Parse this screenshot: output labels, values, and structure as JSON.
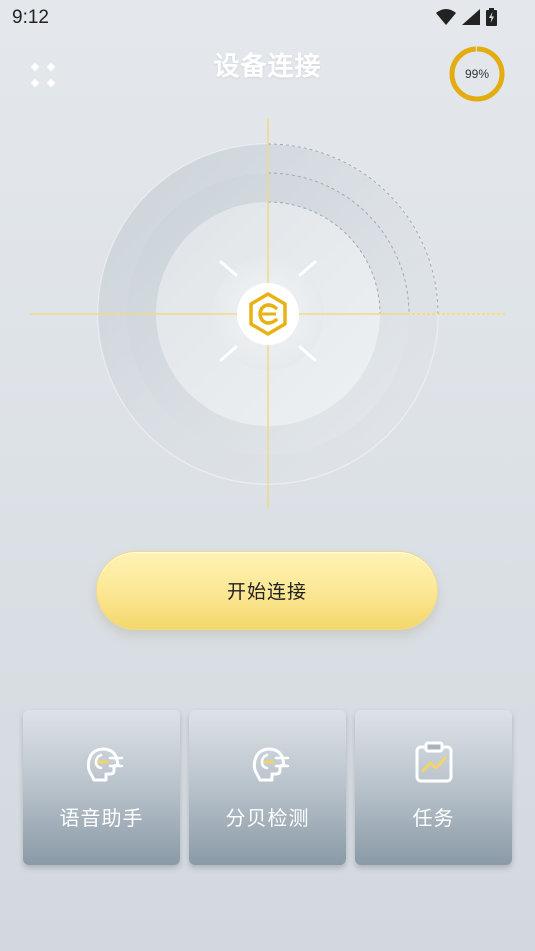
{
  "status_bar": {
    "time": "9:12",
    "icons": [
      "wifi-icon",
      "signal-icon",
      "battery-charging-icon"
    ]
  },
  "header": {
    "title": "设备连接",
    "menu_icon": "grid-dots-icon",
    "battery_percent": "99%",
    "battery_level": 0.99,
    "ring_color": "#e3ad10"
  },
  "radar": {
    "center_icon": "brand-logo-icon",
    "accent_color": "#e8b214"
  },
  "start_button": {
    "label": "开始连接"
  },
  "tiles": [
    {
      "label": "语音助手",
      "icon": "voice-assistant-icon"
    },
    {
      "label": "分贝检测",
      "icon": "decibel-detect-icon"
    },
    {
      "label": "任务",
      "icon": "task-clipboard-icon"
    }
  ]
}
